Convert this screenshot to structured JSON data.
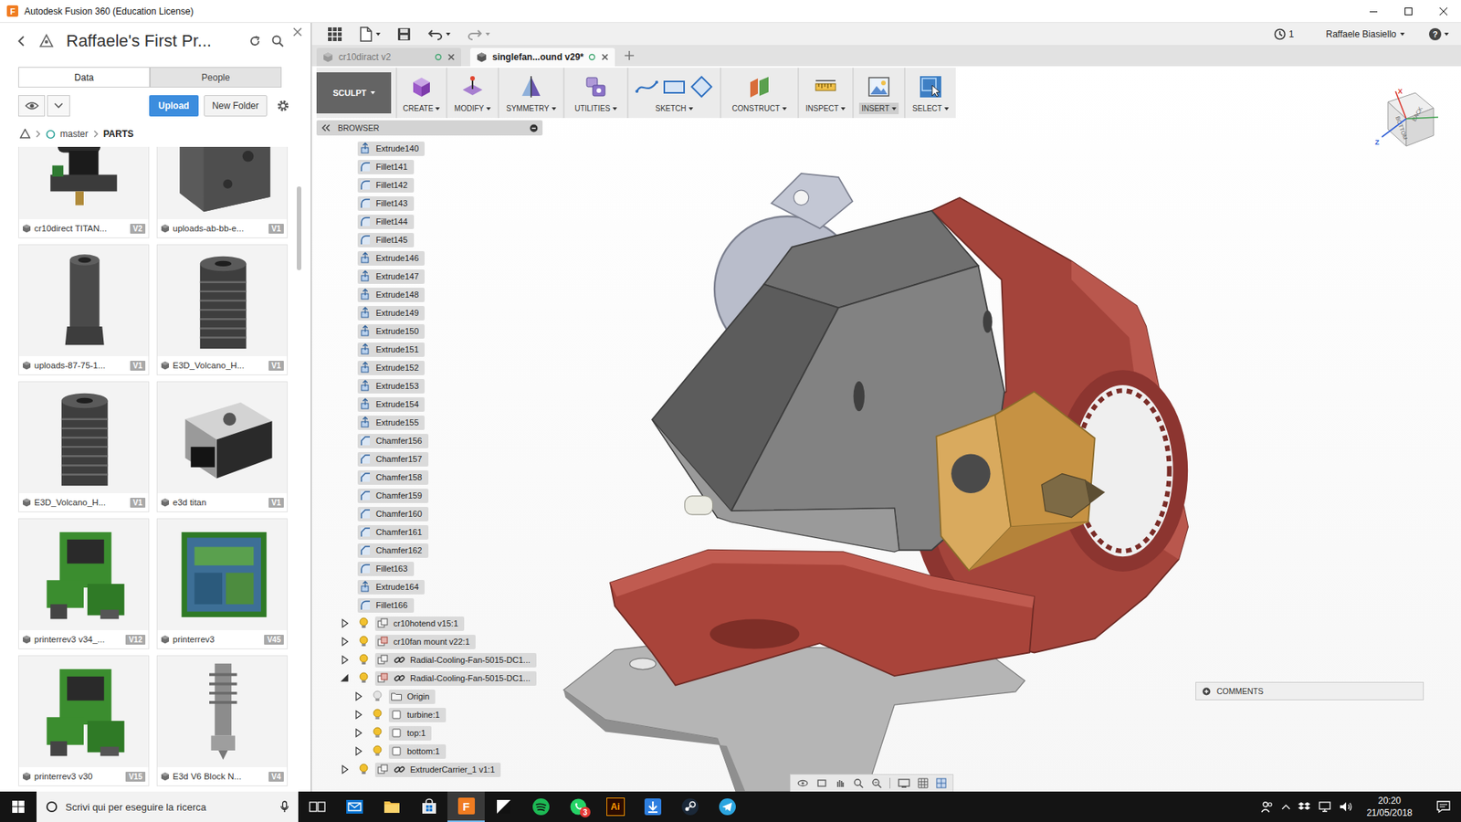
{
  "window": {
    "title": "Autodesk Fusion 360 (Education License)",
    "app_glyph": "F"
  },
  "data_panel": {
    "project": "Raffaele's First Pr...",
    "tabs": [
      {
        "label": "Data",
        "selected": true
      },
      {
        "label": "People",
        "selected": false
      }
    ],
    "upload": "Upload",
    "new_folder": "New Folder",
    "breadcrumb": [
      {
        "label": "master",
        "current": false
      },
      {
        "label": "PARTS",
        "current": true
      }
    ],
    "items": [
      {
        "name": "cr10direct TITAN...",
        "version": "V2",
        "kind": "assembly"
      },
      {
        "name": "uploads-ab-bb-e...",
        "version": "V1",
        "kind": "block"
      },
      {
        "name": "uploads-87-75-1...",
        "version": "V1",
        "kind": "tube"
      },
      {
        "name": "E3D_Volcano_H...",
        "version": "V1",
        "kind": "heatsink"
      },
      {
        "name": "E3D_Volcano_H...",
        "version": "V1",
        "kind": "heatsink"
      },
      {
        "name": "e3d titan",
        "version": "V1",
        "kind": "titan"
      },
      {
        "name": "printerrev3 v34_...",
        "version": "V12",
        "kind": "printer"
      },
      {
        "name": "printerrev3",
        "version": "V45",
        "kind": "frame"
      },
      {
        "name": "printerrev3 v30",
        "version": "V15",
        "kind": "printer"
      },
      {
        "name": "E3d V6 Block N...",
        "version": "V4",
        "kind": "v6"
      }
    ]
  },
  "app_bar": {
    "jobs": "1",
    "user": "Raffaele Biasiello",
    "help": "?"
  },
  "doc_tabs": [
    {
      "label": "cr10diract v2",
      "selected": false
    },
    {
      "label": "singlefan...ound v29*",
      "selected": true
    }
  ],
  "toolbar": {
    "mode": "SCULPT",
    "groups": [
      {
        "label": "CREATE",
        "kind": "create",
        "selected": false
      },
      {
        "label": "MODIFY",
        "kind": "modify",
        "selected": false
      },
      {
        "label": "SYMMETRY",
        "kind": "symmetry",
        "selected": false
      },
      {
        "label": "UTILITIES",
        "kind": "utilities",
        "selected": false
      },
      {
        "label": "SKETCH",
        "kind": "sketch",
        "selected": false
      },
      {
        "label": "CONSTRUCT",
        "kind": "construct",
        "selected": false
      },
      {
        "label": "INSPECT",
        "kind": "inspect",
        "selected": false
      },
      {
        "label": "INSERT",
        "kind": "insert",
        "selected": true
      },
      {
        "label": "SELECT",
        "kind": "select",
        "selected": false
      }
    ]
  },
  "browser": {
    "title": "BROWSER",
    "features": [
      {
        "name": "Extrude140",
        "kind": "extrude"
      },
      {
        "name": "Fillet141",
        "kind": "fillet"
      },
      {
        "name": "Fillet142",
        "kind": "fillet"
      },
      {
        "name": "Fillet143",
        "kind": "fillet"
      },
      {
        "name": "Fillet144",
        "kind": "fillet"
      },
      {
        "name": "Fillet145",
        "kind": "fillet"
      },
      {
        "name": "Extrude146",
        "kind": "extrude"
      },
      {
        "name": "Extrude147",
        "kind": "extrude"
      },
      {
        "name": "Extrude148",
        "kind": "extrude"
      },
      {
        "name": "Extrude149",
        "kind": "extrude"
      },
      {
        "name": "Extrude150",
        "kind": "extrude"
      },
      {
        "name": "Extrude151",
        "kind": "extrude"
      },
      {
        "name": "Extrude152",
        "kind": "extrude"
      },
      {
        "name": "Extrude153",
        "kind": "extrude"
      },
      {
        "name": "Extrude154",
        "kind": "extrude"
      },
      {
        "name": "Extrude155",
        "kind": "extrude"
      },
      {
        "name": "Chamfer156",
        "kind": "chamfer"
      },
      {
        "name": "Chamfer157",
        "kind": "chamfer"
      },
      {
        "name": "Chamfer158",
        "kind": "chamfer"
      },
      {
        "name": "Chamfer159",
        "kind": "chamfer"
      },
      {
        "name": "Chamfer160",
        "kind": "chamfer"
      },
      {
        "name": "Chamfer161",
        "kind": "chamfer"
      },
      {
        "name": "Chamfer162",
        "kind": "chamfer"
      },
      {
        "name": "Fillet163",
        "kind": "fillet"
      },
      {
        "name": "Extrude164",
        "kind": "extrude"
      },
      {
        "name": "Fillet166",
        "kind": "fillet"
      }
    ],
    "components": [
      {
        "name": "cr10hotend v15:1",
        "kind": "component",
        "expanded": false,
        "visible": true,
        "linked": false,
        "children": []
      },
      {
        "name": "cr10fan mount v22:1",
        "kind": "assembly",
        "expanded": false,
        "visible": true,
        "linked": false,
        "children": []
      },
      {
        "name": "Radial-Cooling-Fan-5015-DC1...",
        "kind": "component",
        "expanded": false,
        "visible": true,
        "linked": true,
        "children": []
      },
      {
        "name": "Radial-Cooling-Fan-5015-DC1...",
        "kind": "assembly",
        "expanded": true,
        "visible": true,
        "linked": true,
        "children": [
          {
            "name": "Origin",
            "kind": "origin",
            "expanded": false,
            "visible": false
          },
          {
            "name": "turbine:1",
            "kind": "body",
            "expanded": false,
            "visible": true
          },
          {
            "name": "top:1",
            "kind": "body",
            "expanded": false,
            "visible": true
          },
          {
            "name": "bottom:1",
            "kind": "body",
            "expanded": false,
            "visible": true
          }
        ]
      },
      {
        "name": "ExtruderCarrier_1 v1:1",
        "kind": "component",
        "expanded": false,
        "visible": true,
        "linked": true,
        "children": []
      }
    ]
  },
  "viewcube": {
    "faces": [
      "BOTTOM",
      "BACK"
    ],
    "axes": [
      {
        "label": "X",
        "color": "#d9342b"
      },
      {
        "label": "Z",
        "color": "#2f5fd6"
      }
    ]
  },
  "comments": {
    "label": "COMMENTS"
  },
  "taskbar": {
    "search": "Scrivi qui per eseguire la ricerca",
    "apps": [
      {
        "kind": "task-view",
        "active": false
      },
      {
        "kind": "mail",
        "active": false
      },
      {
        "kind": "explorer",
        "active": false
      },
      {
        "kind": "store",
        "active": false
      },
      {
        "kind": "fusion",
        "active": true,
        "glyph": "F"
      },
      {
        "kind": "notes",
        "active": false
      },
      {
        "kind": "spotify",
        "active": false
      },
      {
        "kind": "whatsapp",
        "active": false,
        "badge": "3"
      },
      {
        "kind": "illustrator",
        "active": false,
        "glyph": "Ai"
      },
      {
        "kind": "downloader",
        "active": false
      },
      {
        "kind": "steam",
        "active": false
      },
      {
        "kind": "telegram",
        "active": false
      }
    ],
    "time": "20:20",
    "date": "21/05/2018"
  }
}
